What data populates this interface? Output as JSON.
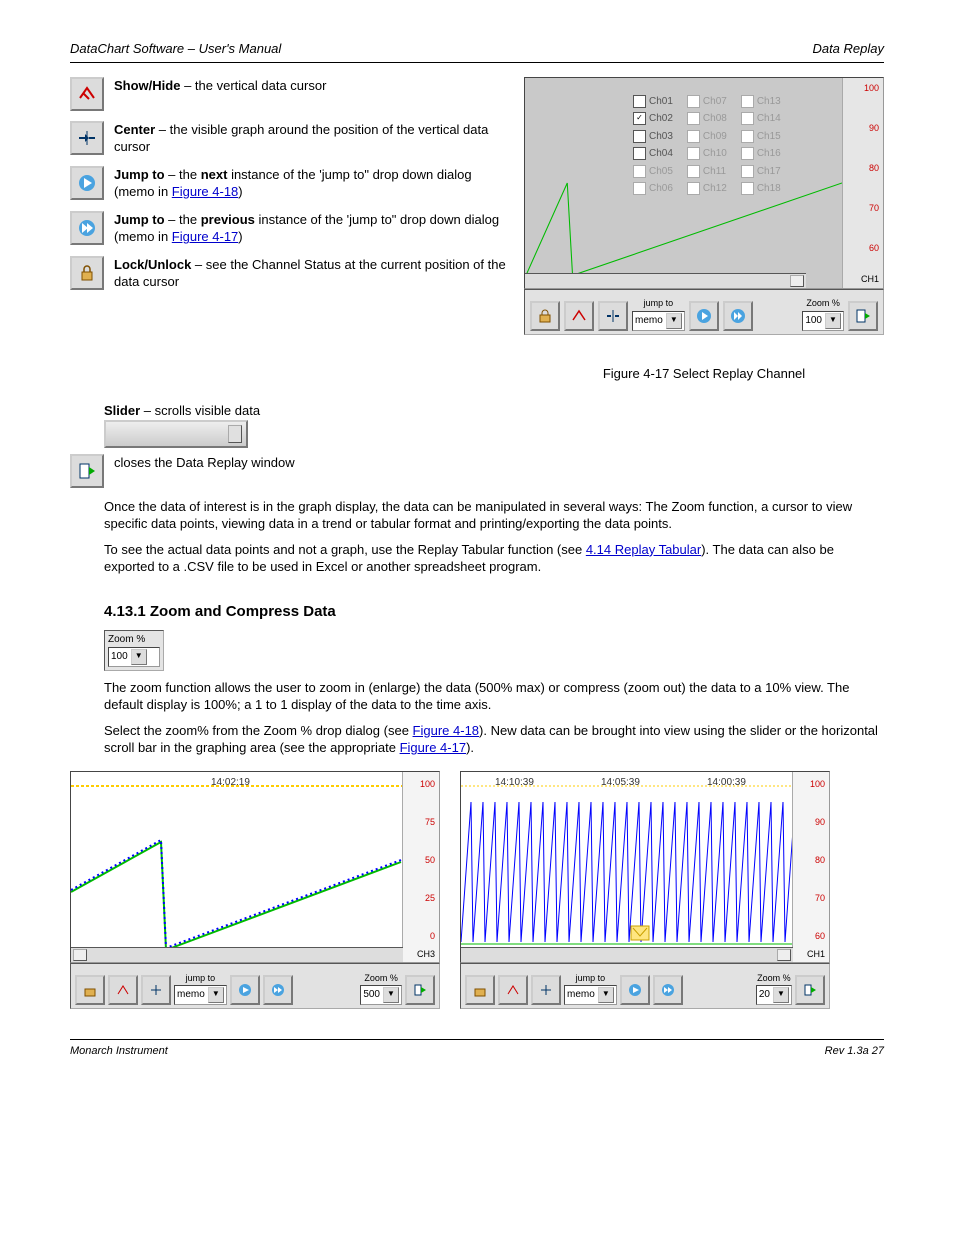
{
  "header": {
    "left": "DataChart Software – User's Manual",
    "right": "Data Replay"
  },
  "bullets": {
    "b1": {
      "label": "Show/Hide",
      "dash": " – ",
      "rest": "the vertical data cursor"
    },
    "b2": {
      "label": "Center",
      "dash": " – ",
      "rest": "the visible graph around the position of the vertical data cursor"
    },
    "b3": {
      "label": "Jump to",
      "dash": " – ",
      "rest": "the ",
      "mid": "next",
      "rest2": " instance of the 'jump to\" drop down dialog (memo in ",
      "link": "Figure 4-18",
      "rest3": ")"
    },
    "b4": {
      "label": "Jump to",
      "dash": " – ",
      "rest": "the ",
      "mid": "previous",
      "rest2": " instance of the 'jump to\" drop down dialog (memo in ",
      "link": "Figure 4-17",
      "rest3": ")"
    },
    "b5": {
      "label": "Lock/Unlock",
      "dash": " – ",
      "rest": "see the Channel Status at the current position of the data cursor"
    }
  },
  "slider": {
    "label": "Slider",
    "dash": " – ",
    "rest": "scrolls visible data"
  },
  "closebtn": {
    "label": "",
    "rest": "closes the Data Replay window"
  },
  "fig17": {
    "caption": "Figure 4-17 Select Replay Channel",
    "channels": [
      "Ch01",
      "Ch02",
      "Ch03",
      "Ch04",
      "Ch05",
      "Ch06",
      "Ch07",
      "Ch08",
      "Ch09",
      "Ch10",
      "Ch11",
      "Ch12",
      "Ch13",
      "Ch14",
      "Ch15",
      "Ch16",
      "Ch17",
      "Ch18"
    ],
    "checked": "Ch02",
    "ylabel": "CH1",
    "ticks": [
      "100",
      "90",
      "80",
      "70",
      "60"
    ],
    "toolbar": {
      "jump": "jump to",
      "jump_val": "memo",
      "zoom": "Zoom %",
      "zoom_val": "100"
    }
  },
  "midpara": {
    "p1": "Once the data of interest is in the graph display, the data can be manipulated in several ways: The Zoom function, a cursor to view specific data points, viewing data in a trend or tabular format and printing/exporting the data points.",
    "p2a": "To see the actual data points and not a graph, use the Replay Tabular function (see ",
    "p2link": "4.14 Replay Tabular",
    "p2b": "). The data can also be exported to a .CSV file to be used in Excel or another spreadsheet program."
  },
  "section": {
    "num": "4.13.1",
    "title": "Zoom and Compress Data"
  },
  "zoom_widget": {
    "label": "Zoom %",
    "value": "100"
  },
  "zpara": {
    "p1": "The zoom function allows the user to zoom in (enlarge) the data (500% max) or compress (zoom out) the data to a 10% view. The default display is 100%; a 1 to 1 display of the data to the time axis.",
    "p2a": "Select the zoom% from the Zoom % drop dialog (see ",
    "p2link": "Figure 4-18",
    "p2b": "). New data can be brought into view using the slider or the horizontal scroll bar in the graphing area (see the appropriate ",
    "p2link2": "Figure 4-17",
    "p2c": ")."
  },
  "left_chart": {
    "timestamp": "14:02:19",
    "ticks": [
      "100",
      "75",
      "50",
      "25",
      "0"
    ],
    "ylabel": "CH3",
    "toolbar": {
      "jump": "jump to",
      "jump_val": "memo",
      "zoom": "Zoom %",
      "zoom_val": "500"
    }
  },
  "right_chart": {
    "timestamps": [
      "14:10:39",
      "14:05:39",
      "14:00:39"
    ],
    "ticks": [
      "100",
      "90",
      "80",
      "70",
      "60"
    ],
    "ylabel": "CH1",
    "toolbar": {
      "jump": "jump to",
      "jump_val": "memo",
      "zoom": "Zoom %",
      "zoom_val": "20"
    }
  },
  "footer": {
    "left": "Monarch Instrument",
    "right": "Rev 1.3a    27"
  },
  "chart_data": [
    {
      "type": "line",
      "title": "Zoom 500% replay",
      "x": [
        0,
        20,
        22,
        100
      ],
      "series": [
        {
          "name": "CH3",
          "values": [
            35,
            55,
            5,
            60
          ]
        }
      ],
      "ylim": [
        0,
        100
      ]
    },
    {
      "type": "line",
      "title": "Zoom 20% replay (sawtooth)",
      "x_range": [
        0,
        100
      ],
      "series": [
        {
          "name": "CH1",
          "pattern": "sawtooth",
          "period": 6,
          "low": 62,
          "high": 98
        }
      ],
      "ylim": [
        60,
        100
      ]
    }
  ]
}
